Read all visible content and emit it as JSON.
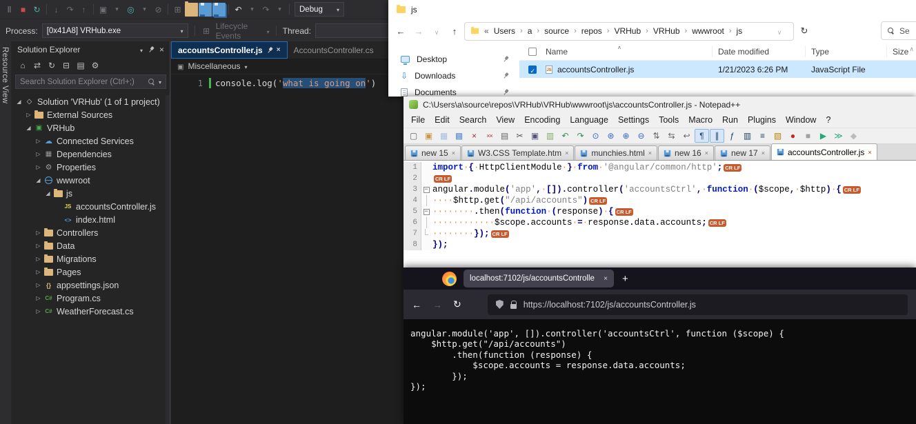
{
  "vs": {
    "resource_view_label": "Resource View",
    "toolbar_row1": {
      "debug_config": "Debug",
      "icons": [
        {
          "icon": "pause-icon",
          "dim": true
        },
        {
          "icon": "stop-debug-icon"
        },
        {
          "icon": "restart-icon"
        },
        {
          "sep": true
        },
        {
          "icon": "step-into-icon",
          "dim": true
        },
        {
          "icon": "step-over-icon",
          "dim": true
        },
        {
          "icon": "step-out-icon",
          "dim": true
        },
        {
          "sep": true
        },
        {
          "icon": "window-icon",
          "dim": true
        },
        {
          "icon": "chevron-down-icon",
          "dim": true
        },
        {
          "icon": "diagnostics-icon"
        },
        {
          "icon": "chevron-down-icon",
          "dim": true
        },
        {
          "icon": "disable-breakpoints-icon",
          "dim": true
        },
        {
          "sep": true
        },
        {
          "icon": "new-window-icon",
          "dim": true
        },
        {
          "icon": "open-folder-icon"
        },
        {
          "icon": "save-icon"
        },
        {
          "icon": "save-all-icon"
        },
        {
          "sep": true
        },
        {
          "icon": "undo-icon"
        },
        {
          "icon": "chevron-down-icon",
          "dim": true
        },
        {
          "icon": "redo-icon",
          "dim": true
        },
        {
          "icon": "chevron-down-icon",
          "dim": true
        },
        {
          "sep": true
        }
      ]
    },
    "toolbar_row2": {
      "process_label": "Process:",
      "process_value": "[0x41A8] VRHub.exe",
      "lifecycle_label": "Lifecycle Events",
      "thread_label": "Thread:"
    },
    "solution_explorer": {
      "title": "Solution Explorer",
      "toolbar_icons": [
        {
          "icon": "home-icon"
        },
        {
          "icon": "sync-with-active-document-icon"
        },
        {
          "icon": "refresh-icon"
        },
        {
          "icon": "collapse-all-icon"
        },
        {
          "icon": "show-all-files-icon"
        },
        {
          "icon": "properties-icon"
        }
      ],
      "search_placeholder": "Search Solution Explorer (Ctrl+;)",
      "tree": [
        {
          "label": "Solution 'VRHub' (1 of 1 project)",
          "icon": "solution",
          "indent": 0,
          "expander": "expanded"
        },
        {
          "label": "External Sources",
          "icon": "folder",
          "indent": 1,
          "expander": "collapsed"
        },
        {
          "label": "VRHub",
          "icon": "project",
          "indent": 1,
          "expander": "expanded"
        },
        {
          "label": "Connected Services",
          "icon": "cloud",
          "indent": 2,
          "expander": "collapsed"
        },
        {
          "label": "Dependencies",
          "icon": "dependencies",
          "indent": 2,
          "expander": "collapsed"
        },
        {
          "label": "Properties",
          "icon": "properties",
          "indent": 2,
          "expander": "collapsed"
        },
        {
          "label": "wwwroot",
          "icon": "globe",
          "indent": 2,
          "expander": "expanded"
        },
        {
          "label": "js",
          "icon": "folder",
          "indent": 3,
          "expander": "expanded"
        },
        {
          "label": "accountsController.js",
          "icon": "js",
          "indent": 4,
          "expander": "none"
        },
        {
          "label": "index.html",
          "icon": "html",
          "indent": 4,
          "expander": "none"
        },
        {
          "label": "Controllers",
          "icon": "folder",
          "indent": 2,
          "expander": "collapsed"
        },
        {
          "label": "Data",
          "icon": "folder",
          "indent": 2,
          "expander": "collapsed"
        },
        {
          "label": "Migrations",
          "icon": "folder",
          "indent": 2,
          "expander": "collapsed"
        },
        {
          "label": "Pages",
          "icon": "folder",
          "indent": 2,
          "expander": "collapsed"
        },
        {
          "label": "appsettings.json",
          "icon": "json",
          "indent": 2,
          "expander": "collapsed"
        },
        {
          "label": "Program.cs",
          "icon": "cs",
          "indent": 2,
          "expander": "collapsed"
        },
        {
          "label": "WeatherForecast.cs",
          "icon": "cs",
          "indent": 2,
          "expander": "collapsed"
        }
      ]
    },
    "editor": {
      "tabs": [
        {
          "label": "accountsController.js",
          "active": true
        },
        {
          "label": "AccountsController.cs",
          "active": false
        }
      ],
      "breadcrumb": "Miscellaneous",
      "line_number": "1",
      "code": {
        "prefix": "console.log(",
        "string_open": "'",
        "selected_text": "what is going on",
        "string_close": "'",
        "suffix": ")"
      }
    }
  },
  "file_explorer": {
    "window_title": "js",
    "overflow_chevron": "«",
    "breadcrumbs": [
      "Users",
      "a",
      "source",
      "repos",
      "VRHub",
      "VRHub",
      "wwwroot",
      "js"
    ],
    "search_text": "Se",
    "sidebar": [
      {
        "label": "Desktop",
        "icon": "desktop-icon"
      },
      {
        "label": "Downloads",
        "icon": "downloads-icon"
      },
      {
        "label": "Documents",
        "icon": "documents-icon"
      }
    ],
    "columns": [
      "Name",
      "Date modified",
      "Type",
      "Size"
    ],
    "files": [
      {
        "name": "accountsController.js",
        "date_modified": "1/21/2023 6:26 PM",
        "type": "JavaScript File",
        "size": "",
        "selected": true
      }
    ]
  },
  "notepadpp": {
    "window_title": "C:\\Users\\a\\source\\repos\\VRHub\\VRHub\\wwwroot\\js\\accountsController.js - Notepad++",
    "menus": [
      "File",
      "Edit",
      "Search",
      "View",
      "Encoding",
      "Language",
      "Settings",
      "Tools",
      "Macro",
      "Run",
      "Plugins",
      "Window",
      "?"
    ],
    "toolbar_icons": [
      {
        "icon": "new-file-icon"
      },
      {
        "icon": "open-file-icon"
      },
      {
        "icon": "save-file-icon",
        "dim": true
      },
      {
        "icon": "save-all-icon"
      },
      {
        "icon": "close-file-icon"
      },
      {
        "icon": "close-all-icon"
      },
      {
        "icon": "print-icon"
      },
      {
        "icon": "cut-icon"
      },
      {
        "icon": "copy-icon"
      },
      {
        "icon": "paste-icon"
      },
      {
        "icon": "undo-icon"
      },
      {
        "icon": "redo-icon"
      },
      {
        "icon": "find-icon"
      },
      {
        "icon": "replace-icon"
      },
      {
        "icon": "zoom-in-icon"
      },
      {
        "icon": "zoom-out-icon"
      },
      {
        "icon": "vertical-sync-icon"
      },
      {
        "icon": "horizontal-sync-icon"
      },
      {
        "icon": "word-wrap-icon"
      },
      {
        "icon": "show-all-characters-icon",
        "active": true
      },
      {
        "icon": "indent-guide-icon",
        "active": true
      },
      {
        "icon": "function-list-icon"
      },
      {
        "icon": "document-map-icon"
      },
      {
        "icon": "document-list-icon"
      },
      {
        "icon": "folder-as-workspace-icon"
      },
      {
        "icon": "record-macro-icon"
      },
      {
        "icon": "stop-macro-icon",
        "dim": true
      },
      {
        "icon": "play-macro-icon"
      },
      {
        "icon": "run-macro-multiple-icon"
      },
      {
        "icon": "save-macro-icon",
        "dim": true
      }
    ],
    "tabs": [
      {
        "label": "new 15",
        "active": false
      },
      {
        "label": "W3.CSS Template.htm",
        "active": false
      },
      {
        "label": "munchies.html",
        "active": false
      },
      {
        "label": "new 16",
        "active": false
      },
      {
        "label": "new 17",
        "active": false
      },
      {
        "label": "accountsController.js",
        "active": true
      }
    ],
    "eol_marker": "CR LF",
    "code_lines": [
      {
        "num": 1,
        "fold": "",
        "crlf": true,
        "tokens": [
          [
            "kw",
            "import"
          ],
          [
            "ws",
            "·"
          ],
          [
            "op",
            "{"
          ],
          [
            "ws",
            "·"
          ],
          [
            "id",
            "HttpClientModule"
          ],
          [
            "ws",
            "·"
          ],
          [
            "op",
            "}"
          ],
          [
            "ws",
            "·"
          ],
          [
            "kw",
            "from"
          ],
          [
            "ws",
            "·"
          ],
          [
            "str",
            "'@angular/common/http'"
          ],
          [
            "op",
            ";"
          ]
        ]
      },
      {
        "num": 2,
        "fold": "",
        "crlf": true,
        "tokens": []
      },
      {
        "num": 3,
        "fold": "open",
        "crlf": true,
        "tokens": [
          [
            "id",
            "angular"
          ],
          [
            "op",
            "."
          ],
          [
            "id",
            "module"
          ],
          [
            "op",
            "("
          ],
          [
            "str",
            "'app'"
          ],
          [
            "op",
            ","
          ],
          [
            "ws",
            "·"
          ],
          [
            "op",
            "[])."
          ],
          [
            "id",
            "controller"
          ],
          [
            "op",
            "("
          ],
          [
            "str",
            "'accountsCtrl'"
          ],
          [
            "op",
            ","
          ],
          [
            "ws",
            "·"
          ],
          [
            "kw",
            "function"
          ],
          [
            "ws",
            "·"
          ],
          [
            "op",
            "("
          ],
          [
            "id",
            "$scope"
          ],
          [
            "op",
            ","
          ],
          [
            "ws",
            "·"
          ],
          [
            "id",
            "$http"
          ],
          [
            "op",
            ")"
          ],
          [
            "ws",
            "·"
          ],
          [
            "op",
            "{"
          ]
        ]
      },
      {
        "num": 4,
        "fold": "line",
        "crlf": true,
        "tokens": [
          [
            "ws",
            "····"
          ],
          [
            "id",
            "$http"
          ],
          [
            "op",
            "."
          ],
          [
            "id",
            "get"
          ],
          [
            "op",
            "("
          ],
          [
            "str",
            "\"/api/accounts\""
          ],
          [
            "op",
            ")"
          ]
        ]
      },
      {
        "num": 5,
        "fold": "open",
        "crlf": true,
        "tokens": [
          [
            "ws",
            "········"
          ],
          [
            "op",
            "."
          ],
          [
            "id",
            "then"
          ],
          [
            "op",
            "("
          ],
          [
            "kw",
            "function"
          ],
          [
            "ws",
            "·"
          ],
          [
            "op",
            "("
          ],
          [
            "id",
            "response"
          ],
          [
            "op",
            ")"
          ],
          [
            "ws",
            "·"
          ],
          [
            "op",
            "{"
          ]
        ]
      },
      {
        "num": 6,
        "fold": "line",
        "crlf": true,
        "tokens": [
          [
            "ws",
            "············"
          ],
          [
            "id",
            "$scope"
          ],
          [
            "op",
            "."
          ],
          [
            "id",
            "accounts"
          ],
          [
            "ws",
            "·"
          ],
          [
            "op",
            "="
          ],
          [
            "ws",
            "·"
          ],
          [
            "id",
            "response"
          ],
          [
            "op",
            "."
          ],
          [
            "id",
            "data"
          ],
          [
            "op",
            "."
          ],
          [
            "id",
            "accounts"
          ],
          [
            "op",
            ";"
          ]
        ]
      },
      {
        "num": 7,
        "fold": "end",
        "crlf": true,
        "tokens": [
          [
            "ws",
            "········"
          ],
          [
            "op",
            "});"
          ]
        ]
      },
      {
        "num": 8,
        "fold": "",
        "crlf": false,
        "tokens": [
          [
            "op",
            "});"
          ]
        ]
      }
    ]
  },
  "firefox": {
    "tab_title": "localhost:7102/js/accountsControlle",
    "url": "https://localhost:7102/js/accountsController.js",
    "code_lines": [
      "angular.module('app', []).controller('accountsCtrl', function ($scope) {",
      "    $http.get(\"/api/accounts\")",
      "        .then(function (response) {",
      "            $scope.accounts = response.data.accounts;",
      "        });",
      "});"
    ]
  }
}
